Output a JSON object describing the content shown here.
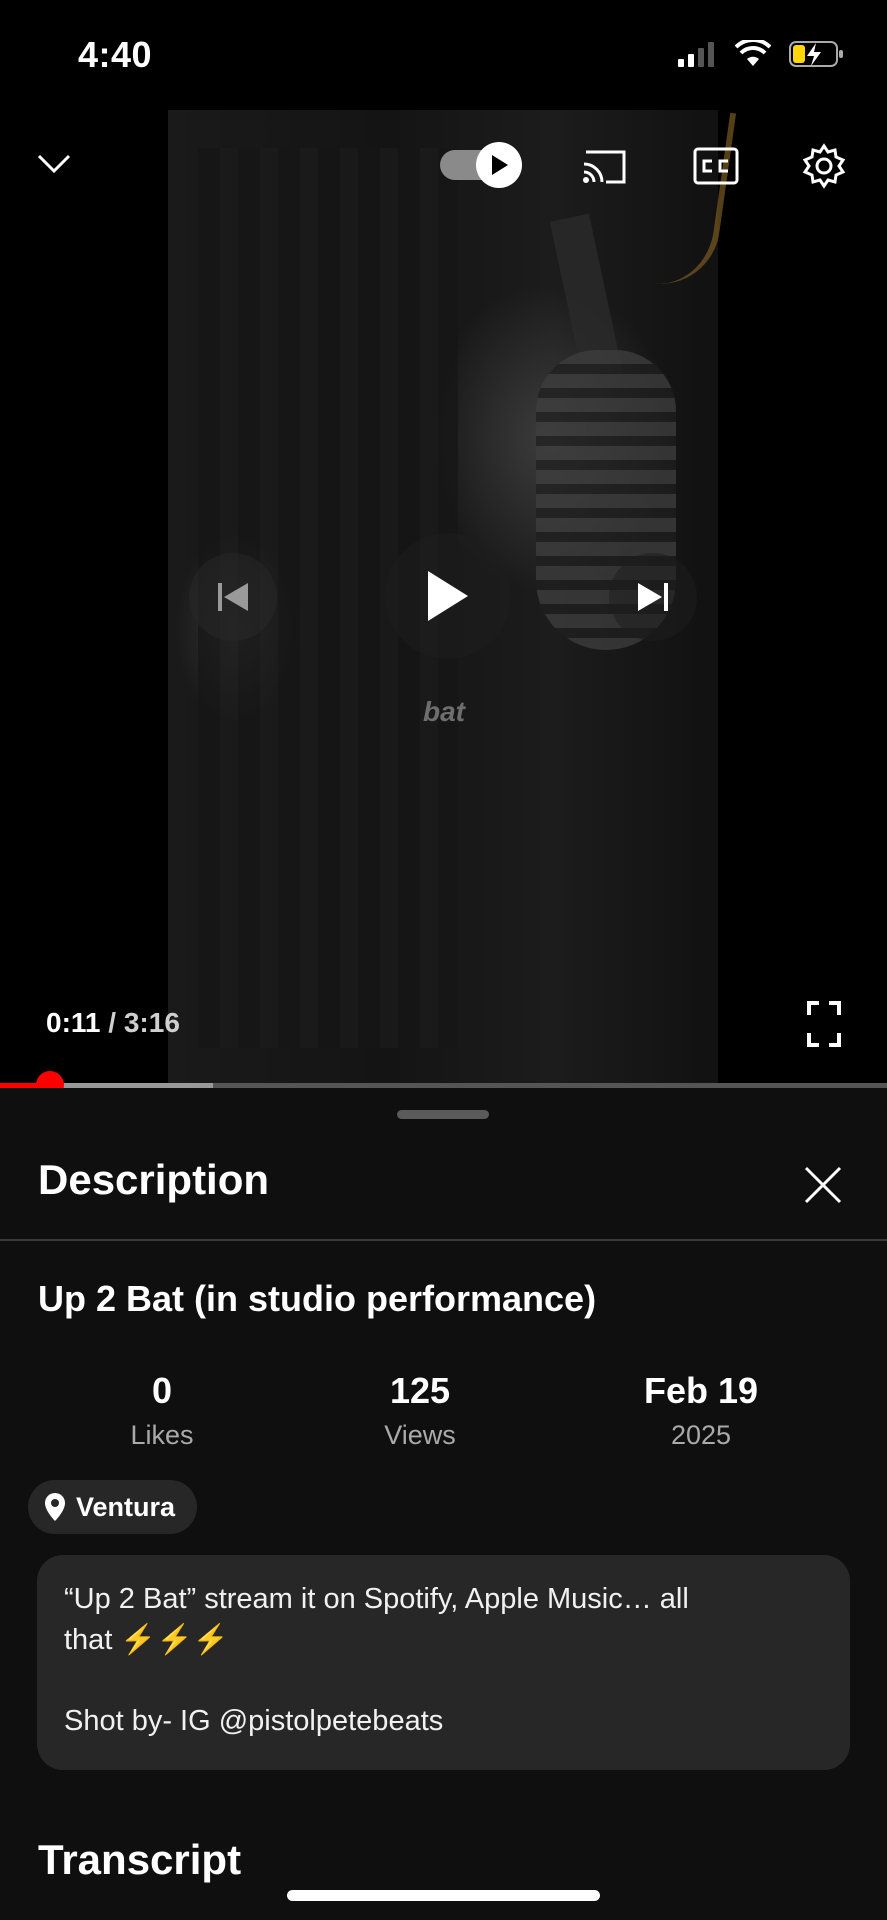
{
  "status_bar": {
    "time": "4:40",
    "icons": [
      "signal-icon",
      "wifi-icon",
      "battery-charging-icon"
    ]
  },
  "player": {
    "caption_word": "bat",
    "current_time": "0:11",
    "separator": " / ",
    "duration": "3:16",
    "progress_fraction": 0.056,
    "buffered_fraction": 0.24,
    "autoplay_on": true,
    "accent_color": "#ff0000",
    "icons": [
      "chevron-down-icon",
      "autoplay-toggle-icon",
      "cast-icon",
      "closed-captions-icon",
      "gear-icon",
      "previous-icon",
      "play-icon",
      "next-icon",
      "fullscreen-icon"
    ]
  },
  "description_panel": {
    "heading": "Description",
    "video_title": "Up 2 Bat (in studio performance)",
    "stats": [
      {
        "value": "0",
        "label": "Likes"
      },
      {
        "value": "125",
        "label": "Views"
      },
      {
        "value": "Feb 19",
        "label": "2025"
      }
    ],
    "location": "Ventura",
    "description_lines": [
      "“Up 2 Bat” stream it on Spotify, Apple Music… all",
      "that ⚡️⚡️⚡️",
      "Shot by- IG @pistolpetebeats"
    ],
    "transcript_heading": "Transcript"
  }
}
